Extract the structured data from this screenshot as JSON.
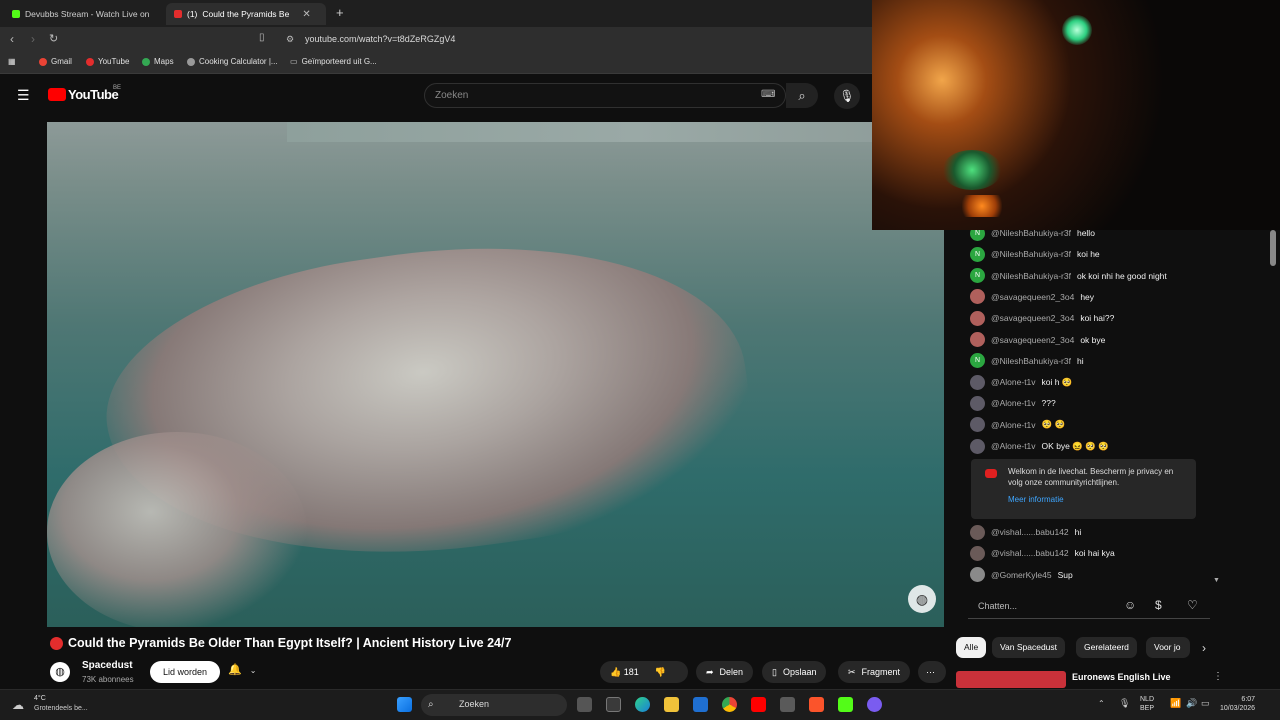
{
  "browser": {
    "tabs": [
      {
        "label": "Devubbs Stream - Watch Live on"
      },
      {
        "label": "Could the Pyramids Be",
        "badge": "(1)"
      }
    ],
    "url": "youtube.com/watch?v=t8dZeRGZgV4",
    "bookmarks": [
      "Gmail",
      "YouTube",
      "Maps",
      "Cooking Calculator |...",
      "Geïmporteerd uit G..."
    ]
  },
  "youtube": {
    "logo": "YouTube",
    "region": "BE",
    "search_placeholder": "Zoeken"
  },
  "video": {
    "title": "Could the Pyramids Be Older Than Egypt Itself? | Ancient History Live 24/7",
    "channel": "Spacedust",
    "subscribers": "73K abonnees",
    "join_label": "Lid worden",
    "likes": "181",
    "share_label": "Delen",
    "save_label": "Opslaan",
    "clip_label": "Fragment"
  },
  "chat": {
    "messages": [
      {
        "author": "@NileshBahukiya-r3f",
        "text": "hello",
        "initial": "N",
        "color": "#2ba640"
      },
      {
        "author": "@NileshBahukiya-r3f",
        "text": "koi he",
        "initial": "N",
        "color": "#2ba640"
      },
      {
        "author": "@NileshBahukiya-r3f",
        "text": "ok koi nhi he good night",
        "initial": "N",
        "color": "#2ba640"
      },
      {
        "author": "@savagequeen2_3o4",
        "text": "hey",
        "initial": "",
        "color": "#b0605c"
      },
      {
        "author": "@savagequeen2_3o4",
        "text": "koi hai??",
        "initial": "",
        "color": "#b0605c"
      },
      {
        "author": "@savagequeen2_3o4",
        "text": "ok bye",
        "initial": "",
        "color": "#b0605c"
      },
      {
        "author": "@NileshBahukiya-r3f",
        "text": "hi",
        "initial": "N",
        "color": "#2ba640"
      },
      {
        "author": "@Alone-t1v",
        "text": "koi h 🥺",
        "initial": "",
        "color": "#5d5a66"
      },
      {
        "author": "@Alone-t1v",
        "text": "???",
        "initial": "",
        "color": "#5d5a66"
      },
      {
        "author": "@Alone-t1v",
        "text": "🥺 🥺",
        "initial": "",
        "color": "#5d5a66"
      },
      {
        "author": "@Alone-t1v",
        "text": "OK bye 😖 🥺 🥺",
        "initial": "",
        "color": "#5d5a66"
      }
    ],
    "messages_after": [
      {
        "author": "@vishal......babu142",
        "text": "hi",
        "color": "#6a5a58"
      },
      {
        "author": "@vishal......babu142",
        "text": "koi hai kya",
        "color": "#6a5a58"
      },
      {
        "author": "@GomerKyle45",
        "text": "Sup",
        "color": "#8a8a8a"
      }
    ],
    "notice_text": "Welkom in de livechat. Bescherm je privacy en volg onze communityrichtlijnen.",
    "notice_link": "Meer informatie",
    "input_placeholder": "Chatten..."
  },
  "chips": [
    "Alle",
    "Van Spacedust",
    "Gerelateerd",
    "Voor jo"
  ],
  "recommended": {
    "title": "Euronews English Live"
  },
  "taskbar": {
    "temp": "4°C",
    "weather": "Grotendeels be...",
    "search": "Zoeken",
    "lang1": "NLD",
    "lang2": "BEP",
    "time": "6:07",
    "date": "10/03/2026"
  },
  "colors": {
    "accent_red": "#e32d2d",
    "link_blue": "#3ea6ff"
  }
}
